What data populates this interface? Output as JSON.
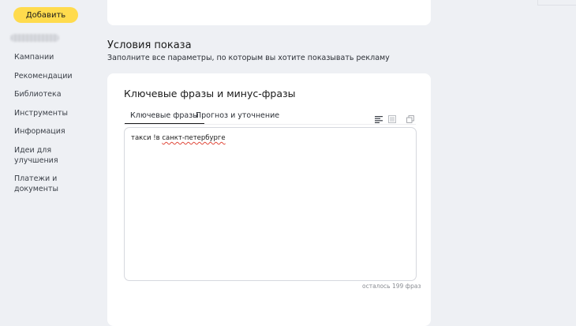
{
  "sidebar": {
    "add_button_label": "Добавить",
    "items": [
      {
        "label": "Кампании"
      },
      {
        "label": "Рекомендации"
      },
      {
        "label": "Библиотека"
      },
      {
        "label": "Инструменты"
      },
      {
        "label": "Информация"
      },
      {
        "label": "Идеи для улучшения"
      },
      {
        "label": "Платежи и документы"
      }
    ]
  },
  "section": {
    "title": "Условия показа",
    "subtitle": "Заполните все параметры, по которым вы хотите показывать рекламу"
  },
  "keywords_card": {
    "title": "Ключевые фразы и минус-фразы",
    "tabs": [
      {
        "label": "Ключевые фразы",
        "active": true
      },
      {
        "label": "Прогноз и уточнение",
        "active": false
      }
    ],
    "tools": [
      "text-align-icon",
      "list-view-icon",
      "copy-icon"
    ],
    "editor": {
      "text_plain": "такси !в ",
      "text_misspelled": "санкт-петербурге"
    },
    "remaining_counter": "осталось 199 фраз"
  },
  "colors": {
    "accent_button": "#ffdb4d",
    "page_background": "#eef0f4",
    "card_background": "#ffffff",
    "spellcheck_underline": "#e0483a"
  }
}
